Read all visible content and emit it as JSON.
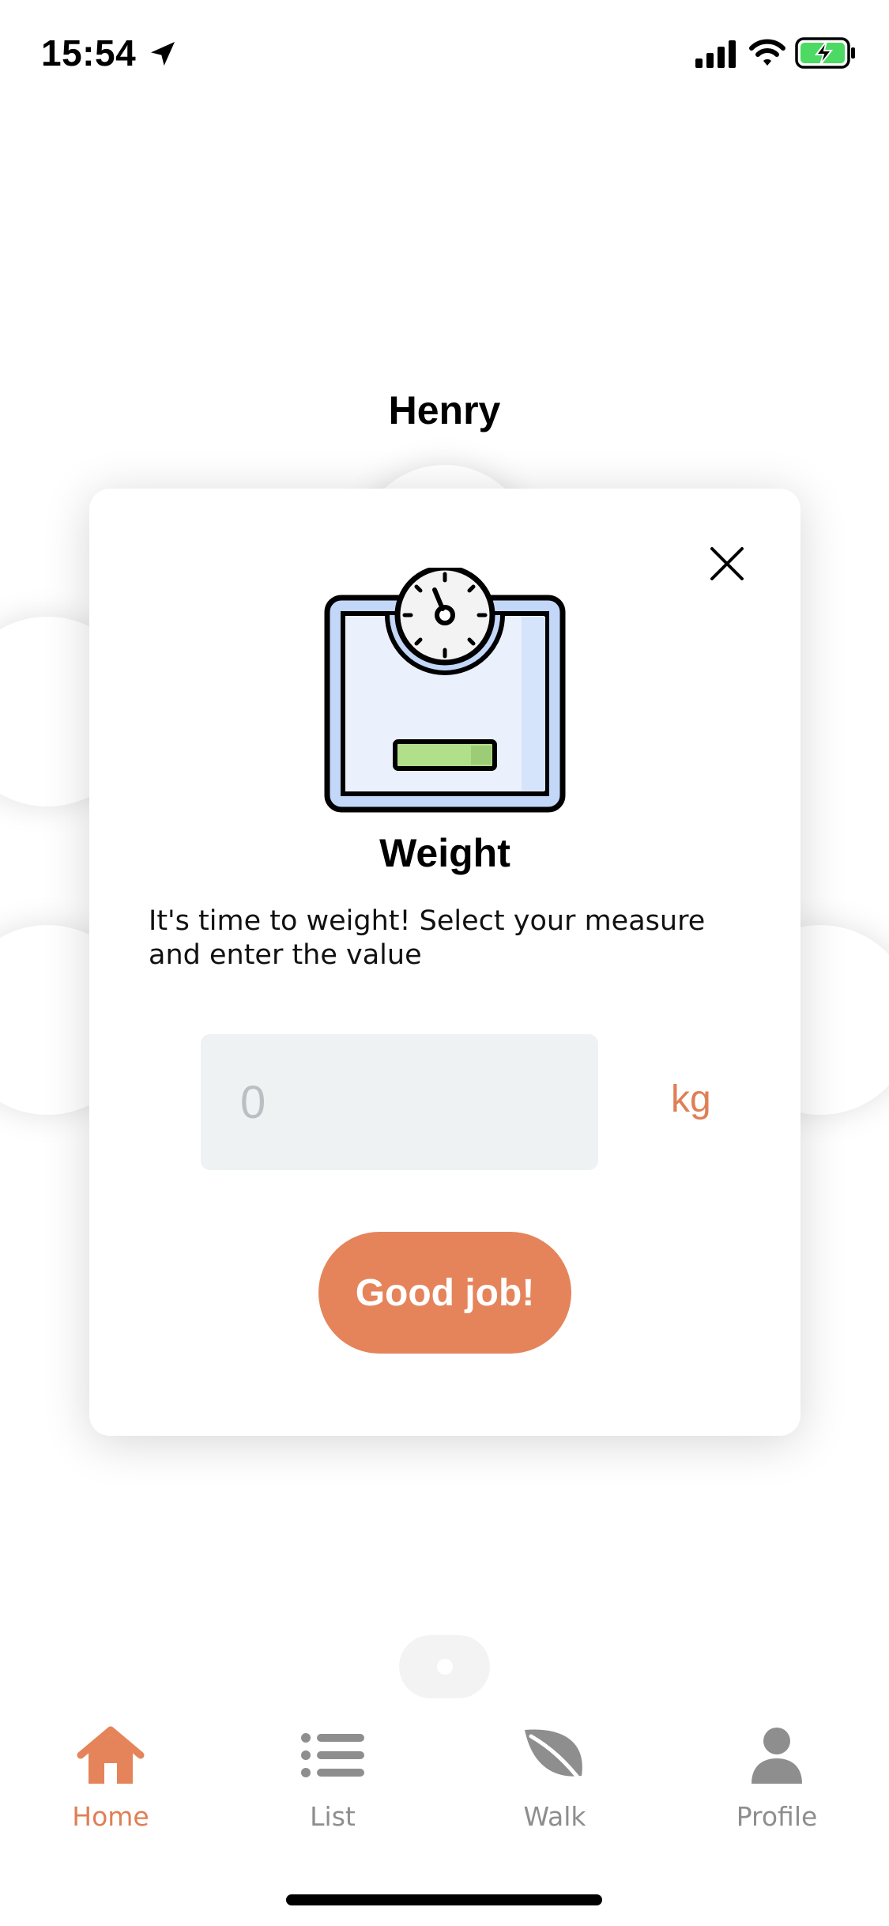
{
  "status_bar": {
    "time": "15:54"
  },
  "background": {
    "pet_name": "Henry"
  },
  "modal": {
    "title": "Weight",
    "description": "It's time to weight! Select your measure and enter the value",
    "input": {
      "placeholder": "0",
      "value": ""
    },
    "unit": "kg",
    "confirm_label": "Good job!"
  },
  "tab_bar": {
    "items": [
      {
        "label": "Home",
        "icon": "home-icon",
        "active": true
      },
      {
        "label": "List",
        "icon": "list-icon",
        "active": false
      },
      {
        "label": "Walk",
        "icon": "leaf-icon",
        "active": false
      },
      {
        "label": "Profile",
        "icon": "person-icon",
        "active": false
      }
    ]
  },
  "colors": {
    "accent": "#e5845a",
    "accent_text": "#e07f55",
    "inactive_tab": "#8e8e8e",
    "input_bg": "#eef2f3",
    "scale_blue": "#c3d7f9",
    "scale_green": "#b2df8a"
  }
}
